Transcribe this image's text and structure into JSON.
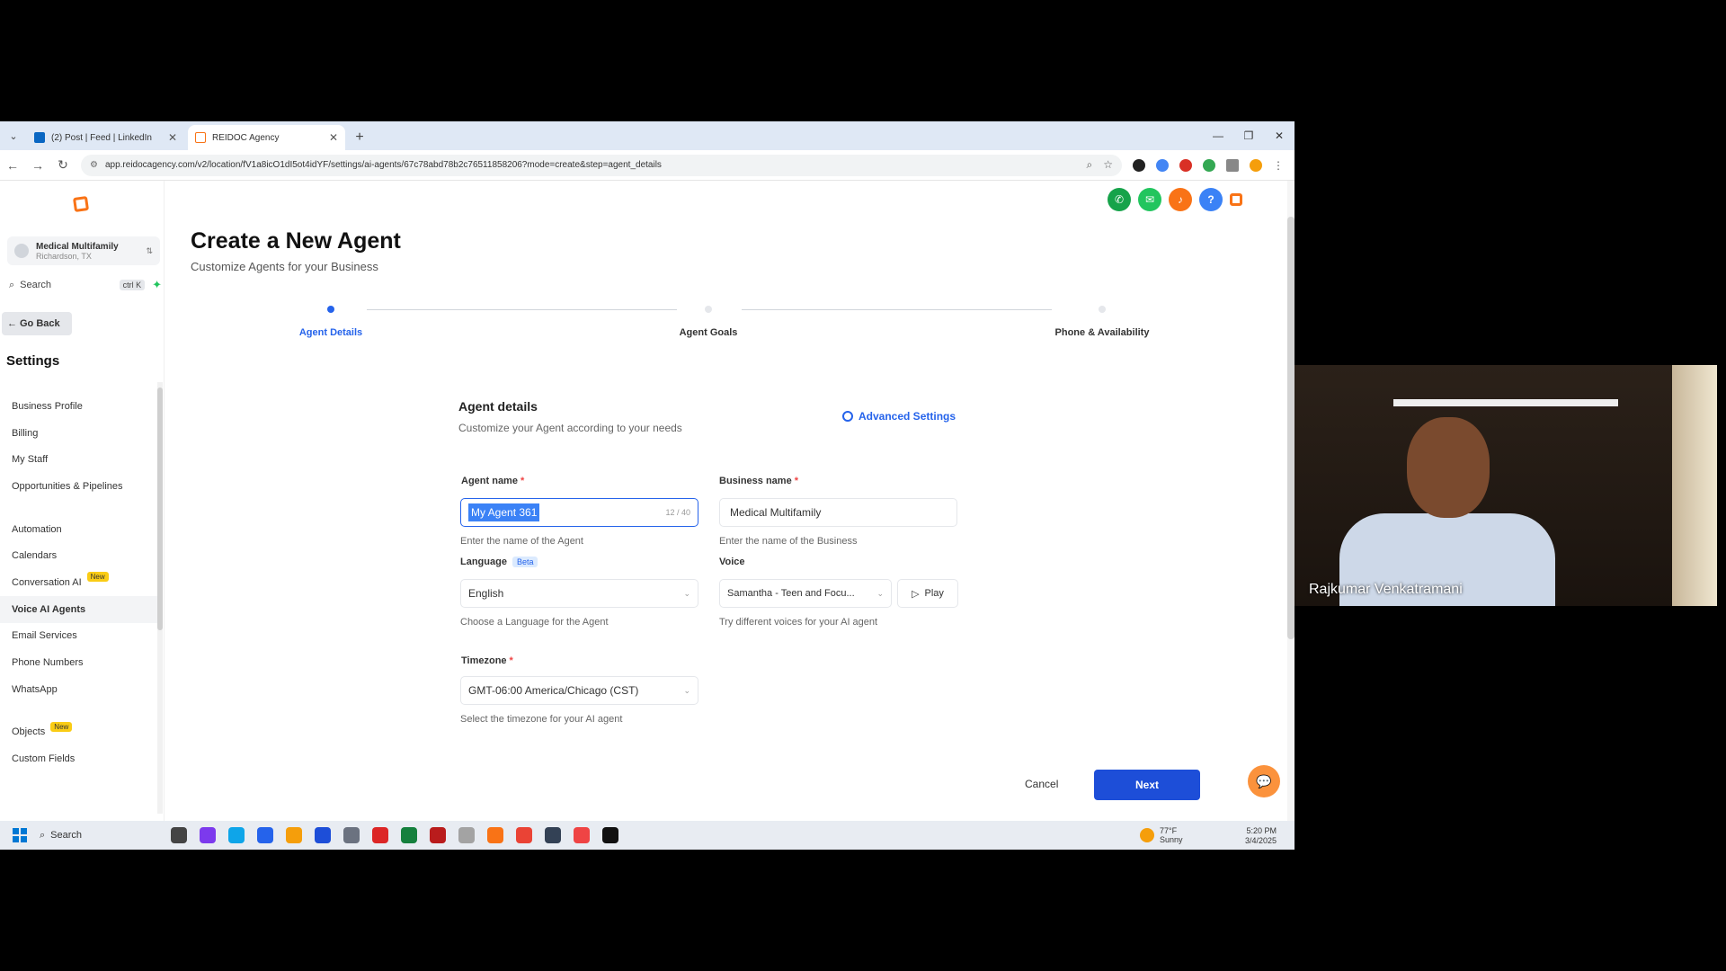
{
  "browser": {
    "tabs": [
      {
        "title": "(2) Post | Feed | LinkedIn",
        "active": false
      },
      {
        "title": "REIDOC Agency",
        "active": true
      }
    ],
    "url": "app.reidocagency.com/v2/location/fV1a8icO1dI5ot4idYF/settings/ai-agents/67c78abd78b2c76511858206?mode=create&step=agent_details"
  },
  "sidebar": {
    "location_name": "Medical Multifamily",
    "location_city": "Richardson, TX",
    "search_label": "Search",
    "search_shortcut": "ctrl K",
    "go_back": "Go Back",
    "settings_title": "Settings",
    "items": [
      {
        "label": "Business Profile"
      },
      {
        "label": "Billing"
      },
      {
        "label": "My Staff"
      },
      {
        "label": "Opportunities & Pipelines"
      },
      {
        "label": "Automation"
      },
      {
        "label": "Calendars"
      },
      {
        "label": "Conversation AI",
        "badge": "New"
      },
      {
        "label": "Voice AI Agents",
        "active": true
      },
      {
        "label": "Email Services"
      },
      {
        "label": "Phone Numbers"
      },
      {
        "label": "WhatsApp"
      },
      {
        "label": "Objects",
        "badge": "New"
      },
      {
        "label": "Custom Fields"
      }
    ]
  },
  "page": {
    "title": "Create a New Agent",
    "subtitle": "Customize Agents for your Business"
  },
  "stepper": {
    "steps": [
      {
        "label": "Agent Details",
        "active": true
      },
      {
        "label": "Agent Goals",
        "active": false
      },
      {
        "label": "Phone & Availability",
        "active": false
      }
    ]
  },
  "form": {
    "title": "Agent details",
    "subtitle": "Customize your Agent according to your needs",
    "advanced_settings": "Advanced Settings",
    "agent_name": {
      "label": "Agent name",
      "value": "My Agent 361",
      "count": "12 / 40",
      "help": "Enter the name of the Agent"
    },
    "business_name": {
      "label": "Business name",
      "value": "Medical Multifamily",
      "help": "Enter the name of the Business"
    },
    "language": {
      "label": "Language",
      "badge": "Beta",
      "value": "English",
      "help": "Choose a Language for the Agent"
    },
    "voice": {
      "label": "Voice",
      "value": "Samantha - Teen and Focu...",
      "play": "Play",
      "help": "Try different voices for your AI agent"
    },
    "timezone": {
      "label": "Timezone",
      "value": "GMT-06:00 America/Chicago (CST)",
      "help": "Select the timezone for your AI agent"
    }
  },
  "footer": {
    "cancel": "Cancel",
    "next": "Next"
  },
  "taskbar": {
    "search": "Search",
    "temperature": "77°F",
    "weather": "Sunny",
    "time": "5:20 PM",
    "date": "3/4/2025"
  },
  "webcam": {
    "participant_name": "Rajkumar Venkatramani"
  }
}
